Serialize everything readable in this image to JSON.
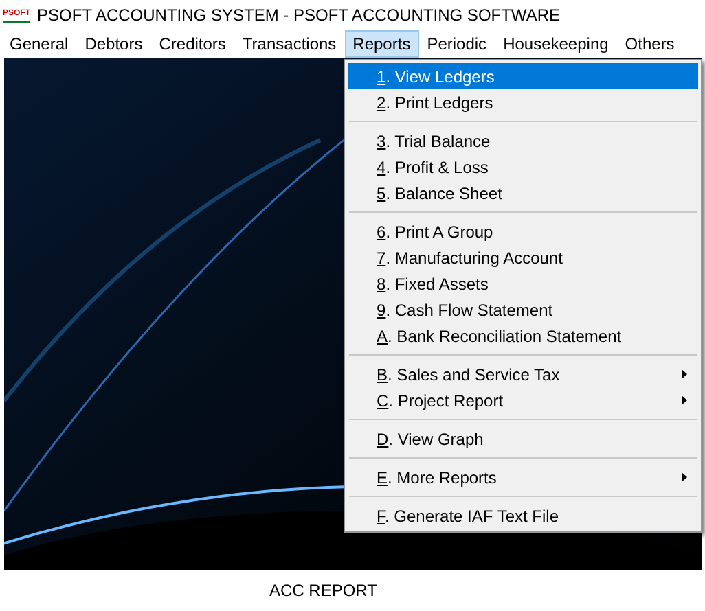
{
  "window": {
    "title": "PSOFT ACCOUNTING SYSTEM - PSOFT ACCOUNTING SOFTWARE",
    "logo": "PSOFT"
  },
  "menu_bar": [
    {
      "label": "General",
      "selected": false
    },
    {
      "label": "Debtors",
      "selected": false
    },
    {
      "label": "Creditors",
      "selected": false
    },
    {
      "label": "Transactions",
      "selected": false
    },
    {
      "label": "Reports",
      "selected": true
    },
    {
      "label": "Periodic",
      "selected": false
    },
    {
      "label": "Housekeeping",
      "selected": false
    },
    {
      "label": "Others",
      "selected": false
    }
  ],
  "dropdown": {
    "groups": [
      [
        {
          "label": "1. View Ledgers",
          "selected": true,
          "submenu": false
        },
        {
          "label": "2. Print Ledgers",
          "selected": false,
          "submenu": false
        }
      ],
      [
        {
          "label": "3. Trial Balance",
          "selected": false,
          "submenu": false
        },
        {
          "label": "4. Profit & Loss",
          "selected": false,
          "submenu": false
        },
        {
          "label": "5. Balance Sheet",
          "selected": false,
          "submenu": false
        }
      ],
      [
        {
          "label": "6. Print A Group",
          "selected": false,
          "submenu": false
        },
        {
          "label": "7. Manufacturing Account",
          "selected": false,
          "submenu": false
        },
        {
          "label": "8. Fixed Assets",
          "selected": false,
          "submenu": false
        },
        {
          "label": "9. Cash Flow Statement",
          "selected": false,
          "submenu": false
        },
        {
          "label": "A. Bank Reconciliation Statement",
          "selected": false,
          "submenu": false
        }
      ],
      [
        {
          "label": "B. Sales and Service Tax",
          "selected": false,
          "submenu": true
        },
        {
          "label": "C. Project Report",
          "selected": false,
          "submenu": true
        }
      ],
      [
        {
          "label": "D. View Graph",
          "selected": false,
          "submenu": false
        }
      ],
      [
        {
          "label": "E. More Reports",
          "selected": false,
          "submenu": true
        }
      ],
      [
        {
          "label": "F. Generate IAF Text File",
          "selected": false,
          "submenu": false
        }
      ]
    ]
  },
  "status_bar": {
    "text": "ACC REPORT"
  }
}
